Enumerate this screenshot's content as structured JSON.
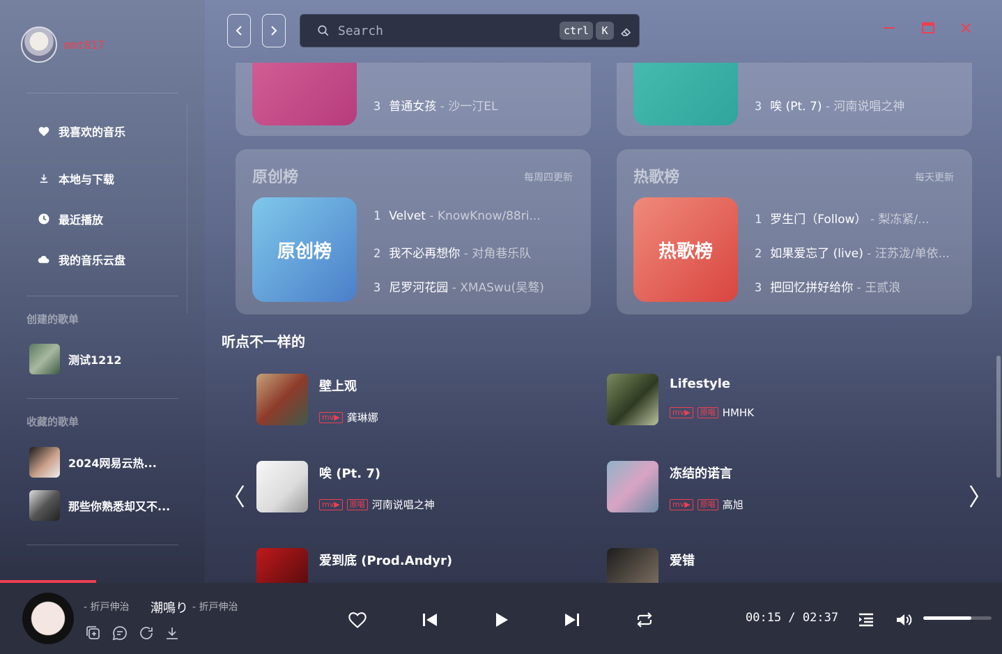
{
  "user": {
    "name": "mmt817"
  },
  "nav": [
    {
      "label": "我喜欢的音乐",
      "icon": "heart-icon"
    },
    {
      "label": "本地与下载",
      "icon": "download-icon"
    },
    {
      "label": "最近播放",
      "icon": "clock-icon"
    },
    {
      "label": "我的音乐云盘",
      "icon": "cloud-icon"
    }
  ],
  "created": {
    "title": "创建的歌单",
    "items": [
      {
        "label": "测试1212"
      }
    ]
  },
  "collected": {
    "title": "收藏的歌单",
    "items": [
      {
        "label": "2024网易云热..."
      },
      {
        "label": "那些你熟悉却又不..."
      }
    ]
  },
  "search": {
    "placeholder": "Search",
    "kbd1": "ctrl",
    "kbd2": "K"
  },
  "top_cards": [
    {
      "row3": {
        "n": "3",
        "title": "普通女孩",
        "artist": "沙一汀EL"
      }
    },
    {
      "row3": {
        "n": "3",
        "title": "唉 (Pt. 7)",
        "artist": "河南说唱之神"
      }
    }
  ],
  "cards": [
    {
      "title": "原创榜",
      "update": "每周四更新",
      "cover_label": "原创榜",
      "songs": [
        {
          "n": "1",
          "title": "Velvet",
          "artist": "KnowKnow/88ri..."
        },
        {
          "n": "2",
          "title": "我不必再想你",
          "artist": "对角巷乐队"
        },
        {
          "n": "3",
          "title": "尼罗河花园",
          "artist": "XMASwu(吴骜)"
        }
      ]
    },
    {
      "title": "热歌榜",
      "update": "每天更新",
      "cover_label": "热歌榜",
      "songs": [
        {
          "n": "1",
          "title": "罗生门（Follow）",
          "artist": "梨冻紧/..."
        },
        {
          "n": "2",
          "title": "如果爱忘了 (live)",
          "artist": "汪苏泷/单依..."
        },
        {
          "n": "3",
          "title": "把回忆拼好给你",
          "artist": "王贰浪"
        }
      ]
    }
  ],
  "section": {
    "title": "听点不一样的"
  },
  "recs": [
    {
      "title": "壁上观",
      "tags": [
        "mv▶"
      ],
      "artist": "龚琳娜"
    },
    {
      "title": "Lifestyle",
      "tags": [
        "mv▶",
        "原唱"
      ],
      "artist": "HMHK"
    },
    {
      "title": "唉 (Pt. 7)",
      "tags": [
        "mv▶",
        "原唱"
      ],
      "artist": "河南说唱之神"
    },
    {
      "title": "冻结的诺言",
      "tags": [
        "mv▶",
        "原唱"
      ],
      "artist": "高旭"
    },
    {
      "title": "爱到底 (Prod.Andyr)",
      "tags": [],
      "artist": ""
    },
    {
      "title": "爱错",
      "tags": [],
      "artist": ""
    }
  ],
  "player": {
    "prefix": "- 折戸伸治",
    "title": "潮鳴り",
    "artist": "- 折戸伸治",
    "time": "00:15 / 02:37",
    "progress": 0.096,
    "volume": 0.7
  },
  "colors": {
    "accent": "#ef3f52",
    "bg_dark": "#2c2f3e"
  }
}
